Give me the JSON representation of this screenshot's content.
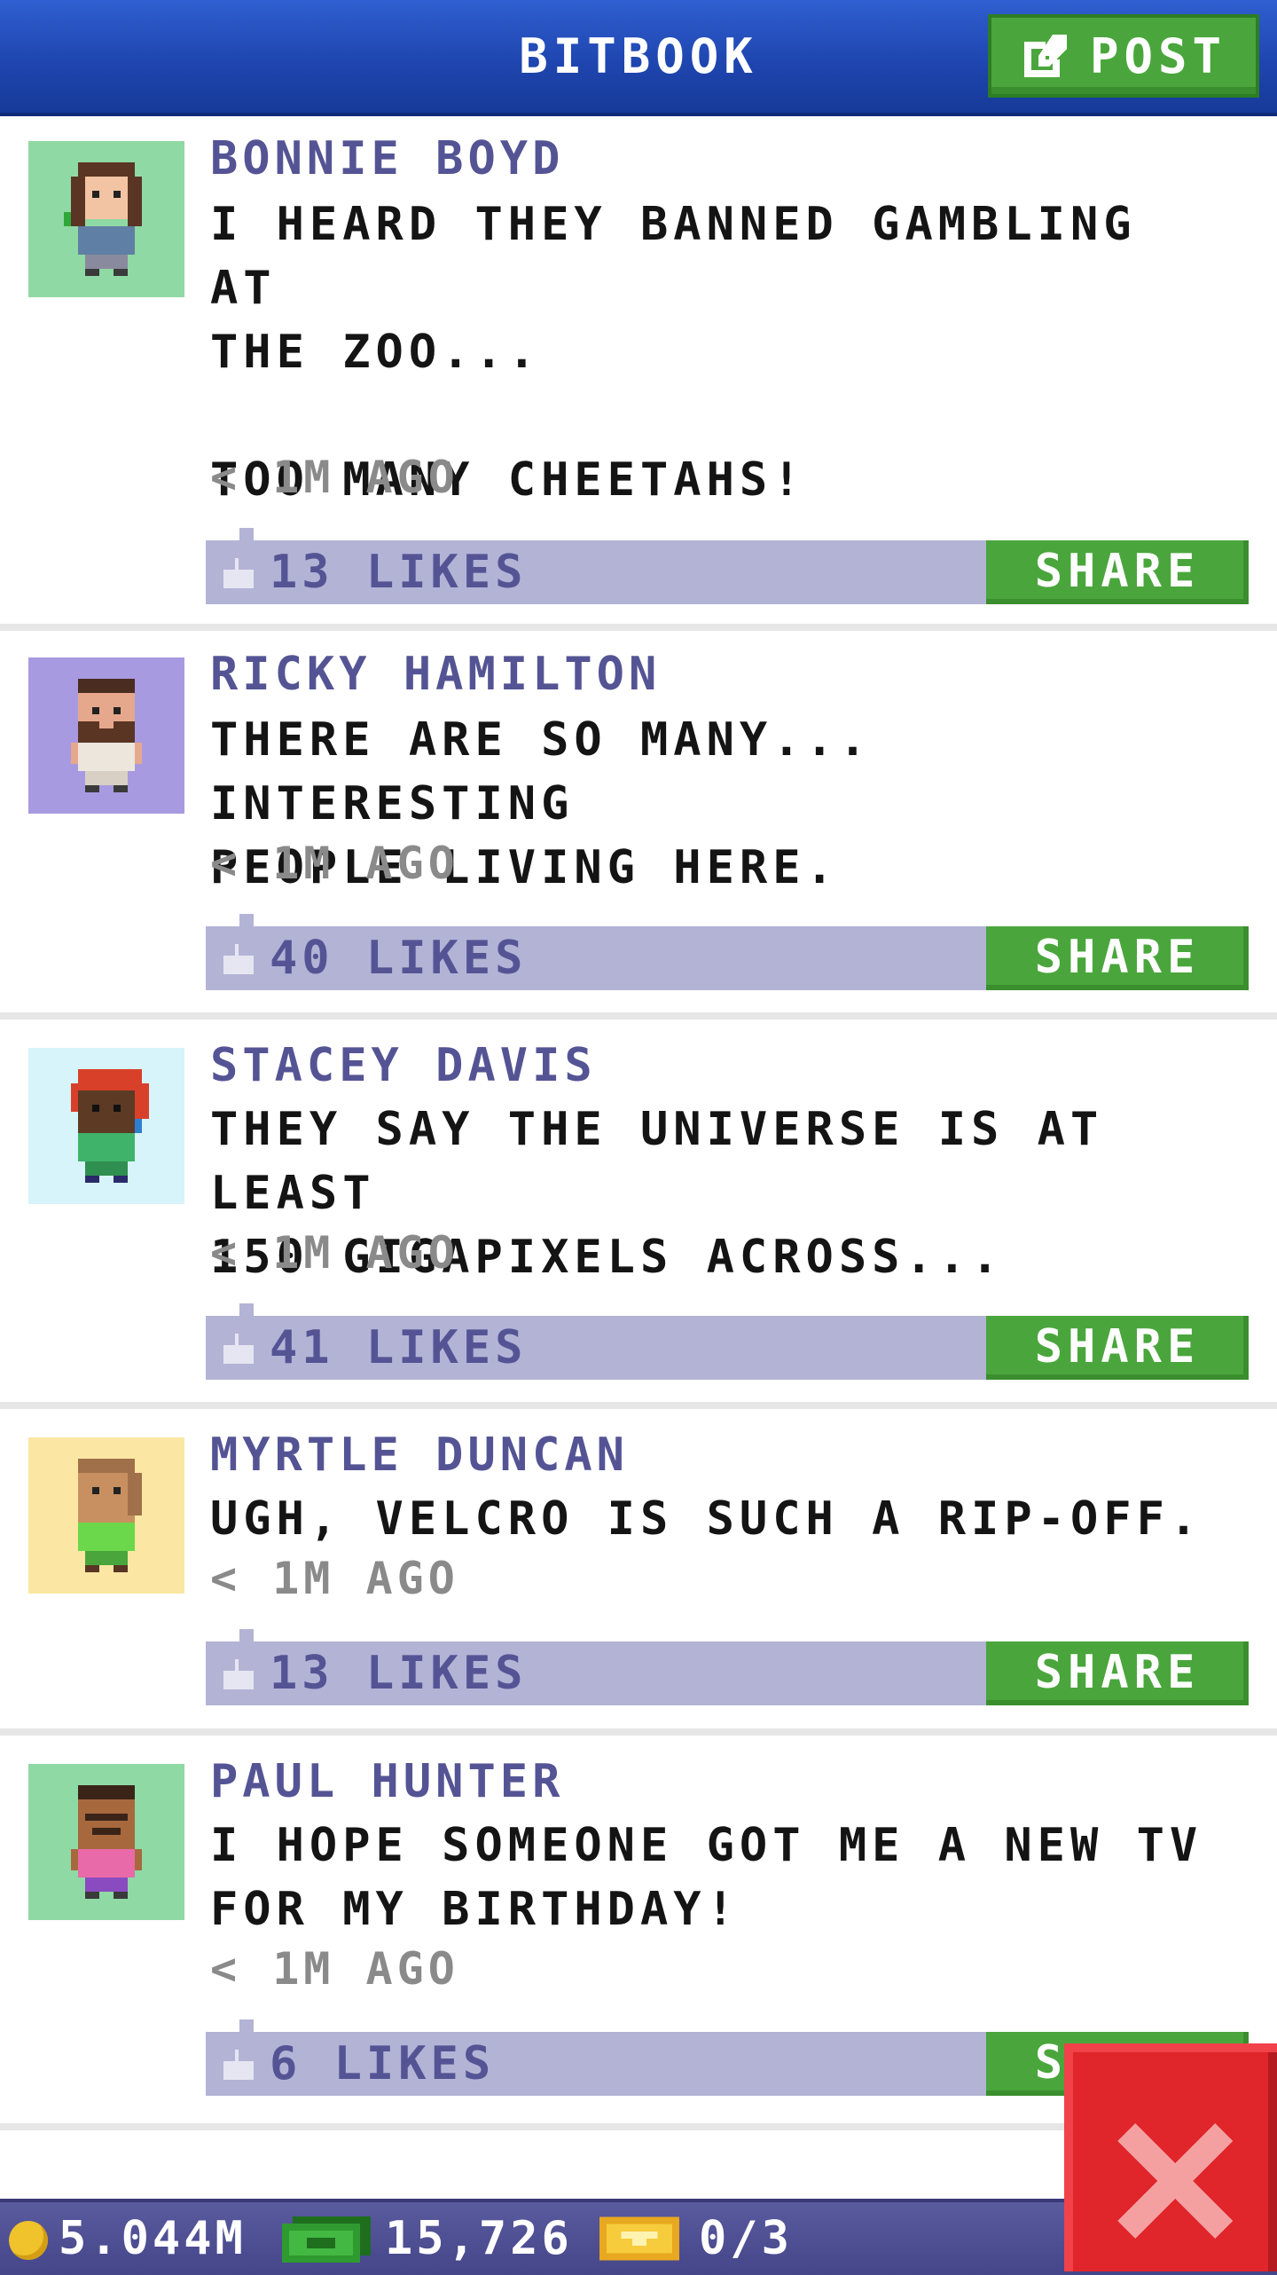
{
  "header": {
    "title": "BITBOOK",
    "post_label": "POST"
  },
  "posts": [
    {
      "author": "BONNIE BOYD",
      "message": "I HEARD THEY BANNED GAMBLING AT\nTHE ZOO...\n\nTOO MANY CHEETAHS!",
      "time": "< 1M AGO",
      "likes": "13 LIKES",
      "share_label": "SHARE",
      "avatar_bg": "#8fd9a4"
    },
    {
      "author": "RICKY HAMILTON",
      "message": "THERE ARE SO MANY... INTERESTING\nPEOPLE LIVING HERE.",
      "time": "< 1M AGO",
      "likes": "40 LIKES",
      "share_label": "SHARE",
      "avatar_bg": "#a89ae0"
    },
    {
      "author": "STACEY DAVIS",
      "message": "THEY SAY THE UNIVERSE IS AT LEAST\n150 GIGAPIXELS ACROSS...",
      "time": "< 1M AGO",
      "likes": "41 LIKES",
      "share_label": "SHARE",
      "avatar_bg": "#d6f4fa"
    },
    {
      "author": "MYRTLE DUNCAN",
      "message": "UGH, VELCRO IS SUCH A RIP-OFF.",
      "time": "< 1M AGO",
      "likes": "13 LIKES",
      "share_label": "SHARE",
      "avatar_bg": "#fbe7a3"
    },
    {
      "author": "PAUL HUNTER",
      "message": "I HOPE SOMEONE GOT ME A NEW TV\nFOR MY BIRTHDAY!",
      "time": "< 1M AGO",
      "likes": "6 LIKES",
      "share_label": "SHARE",
      "avatar_bg": "#8fd9a4"
    }
  ],
  "status_bar": {
    "coins": "5.044M",
    "bux": "15,726",
    "tickets": "0/3"
  },
  "colors": {
    "header_blue": "#1f46b0",
    "green_button": "#4aa63c",
    "like_bar": "#b3b3d6",
    "author_purple": "#545495",
    "close_red": "#e0252b"
  }
}
